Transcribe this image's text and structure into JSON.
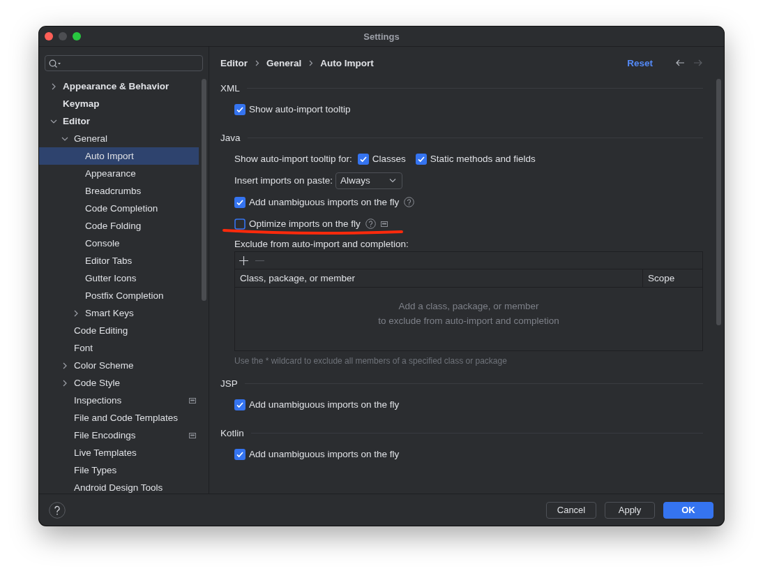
{
  "window": {
    "title": "Settings"
  },
  "tree": [
    {
      "label": "Appearance & Behavior",
      "bold": true,
      "expanded": false,
      "selected": false
    },
    {
      "label": "Keymap",
      "bold": true,
      "selected": false
    },
    {
      "label": "Editor",
      "bold": true,
      "expanded": true,
      "selected": false,
      "children": [
        {
          "label": "General",
          "expanded": true,
          "selected": false,
          "children": [
            {
              "label": "Auto Import",
              "selected": true
            },
            {
              "label": "Appearance",
              "selected": false
            },
            {
              "label": "Breadcrumbs",
              "selected": false
            },
            {
              "label": "Code Completion",
              "selected": false
            },
            {
              "label": "Code Folding",
              "selected": false
            },
            {
              "label": "Console",
              "selected": false
            },
            {
              "label": "Editor Tabs",
              "selected": false
            },
            {
              "label": "Gutter Icons",
              "selected": false
            },
            {
              "label": "Postfix Completion",
              "selected": false
            },
            {
              "label": "Smart Keys",
              "expanded": false,
              "selected": false
            }
          ]
        },
        {
          "label": "Code Editing",
          "selected": false
        },
        {
          "label": "Font",
          "selected": false
        },
        {
          "label": "Color Scheme",
          "expanded": false,
          "selected": false
        },
        {
          "label": "Code Style",
          "expanded": false,
          "selected": false
        },
        {
          "label": "Inspections",
          "badge": true,
          "selected": false
        },
        {
          "label": "File and Code Templates",
          "selected": false
        },
        {
          "label": "File Encodings",
          "badge": true,
          "selected": false
        },
        {
          "label": "Live Templates",
          "selected": false
        },
        {
          "label": "File Types",
          "selected": false
        },
        {
          "label": "Android Design Tools",
          "selected": false
        }
      ]
    }
  ],
  "breadcrumb": [
    "Editor",
    "General",
    "Auto Import"
  ],
  "header_actions": {
    "reset": "Reset",
    "back": {
      "disabled": false
    },
    "forward": {
      "disabled": true
    }
  },
  "sections": [
    {
      "title": "XML",
      "rows": [
        {
          "kind": "checkbox",
          "label": "Show auto-import tooltip",
          "checked": true
        }
      ]
    },
    {
      "title": "Java",
      "rows": [
        {
          "kind": "checkbox-group",
          "label": "Show auto-import tooltip for:",
          "options": [
            {
              "label": "Classes",
              "checked": true
            },
            {
              "label": "Static methods and fields",
              "checked": true
            }
          ]
        },
        {
          "kind": "dropdown",
          "label": "Insert imports on paste:",
          "value": "Always"
        },
        {
          "kind": "checkbox",
          "label": "Add unambiguous imports on the fly",
          "checked": true,
          "help": true
        },
        {
          "kind": "checkbox",
          "label": "Optimize imports on the fly",
          "checked": false,
          "help": true,
          "badge": true,
          "annotated": true
        },
        {
          "kind": "table",
          "label": "Exclude from auto-import and completion:",
          "columns": [
            "Class, package, or member",
            "Scope"
          ],
          "empty_text": [
            "Add a class, package, or member",
            "to exclude from auto-import and completion"
          ],
          "hint": "Use the * wildcard to exclude all members of a specified class or package"
        }
      ]
    },
    {
      "title": "JSP",
      "rows": [
        {
          "kind": "checkbox",
          "label": "Add unambiguous imports on the fly",
          "checked": true
        }
      ]
    },
    {
      "title": "Kotlin",
      "rows": [
        {
          "kind": "checkbox",
          "label": "Add unambiguous imports on the fly",
          "checked": true
        }
      ]
    }
  ],
  "footer": {
    "buttons": [
      {
        "label": "Cancel",
        "kind": "secondary"
      },
      {
        "label": "Apply",
        "kind": "secondary"
      },
      {
        "label": "OK",
        "kind": "primary"
      }
    ]
  }
}
